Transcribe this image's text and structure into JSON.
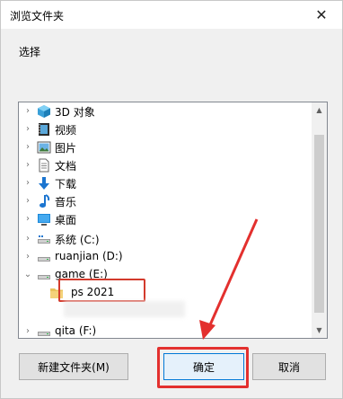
{
  "dialog": {
    "title": "浏览文件夹",
    "instruction": "选择",
    "close_glyph": "✕"
  },
  "tree": {
    "items": [
      {
        "label": "3D 对象",
        "icon": "3d-objects-icon",
        "expander": "›"
      },
      {
        "label": "视频",
        "icon": "videos-icon",
        "expander": "›"
      },
      {
        "label": "图片",
        "icon": "pictures-icon",
        "expander": "›"
      },
      {
        "label": "文档",
        "icon": "documents-icon",
        "expander": "›"
      },
      {
        "label": "下载",
        "icon": "downloads-icon",
        "expander": "›"
      },
      {
        "label": "音乐",
        "icon": "music-icon",
        "expander": "›"
      },
      {
        "label": "桌面",
        "icon": "desktop-icon",
        "expander": "›"
      },
      {
        "label": "系统 (C:)",
        "icon": "drive-icon",
        "expander": "›"
      },
      {
        "label": "ruanjian (D:)",
        "icon": "drive-icon",
        "expander": "›"
      },
      {
        "label": "game (E:)",
        "icon": "drive-icon",
        "expander": "⌄"
      },
      {
        "label": "ps 2021",
        "icon": "folder-icon",
        "expander": ""
      },
      {
        "label": "qita (F:)",
        "icon": "drive-icon",
        "expander": "›"
      }
    ],
    "scroll_up": "▲",
    "scroll_down": "▼"
  },
  "buttons": {
    "new_folder": "新建文件夹(M)",
    "ok": "确定",
    "cancel": "取消"
  },
  "colors": {
    "annotation_red": "#d33a2c",
    "focus_blue": "#0078d7"
  }
}
